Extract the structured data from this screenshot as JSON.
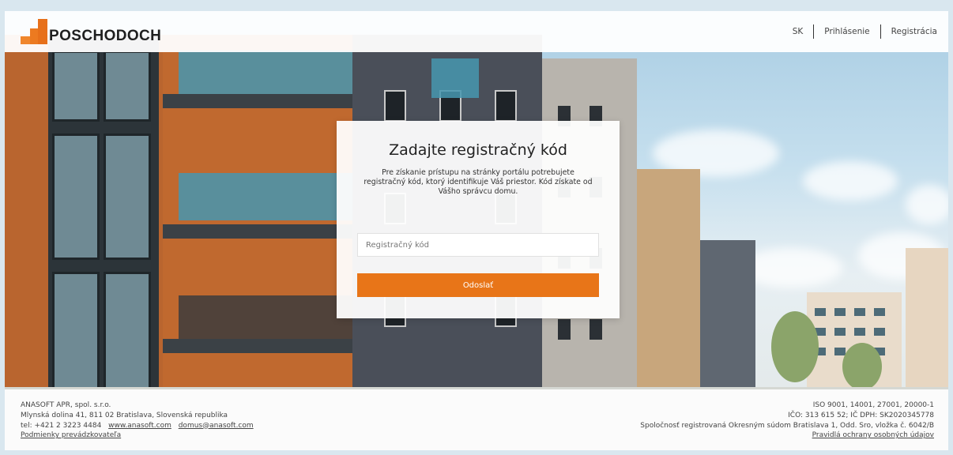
{
  "header": {
    "logo_text": "POSCHODOCH",
    "nav": {
      "language": "SK",
      "login": "Prihlásenie",
      "register": "Registrácia"
    }
  },
  "card": {
    "title": "Zadajte registračný kód",
    "description": "Pre získanie prístupu na stránky portálu potrebujete registračný kód, ktorý identifikuje Váš priestor. Kód získate od Vášho správcu domu.",
    "input_placeholder": "Registračný kód",
    "input_value": "",
    "submit_label": "Odoslať"
  },
  "footer": {
    "left": {
      "company": "ANASOFT APR, spol. s.r.o.",
      "address": "Mlynská dolina 41, 811 02 Bratislava, Slovenská republika",
      "phone": "tel: +421 2 3223 4484",
      "website": "www.anasoft.com",
      "email": "domus@anasoft.com",
      "terms": "Podmienky prevádzkovateľa"
    },
    "right": {
      "iso": "ISO 9001, 14001, 27001, 20000-1",
      "ico": "IČO: 313 615 52; IČ DPH: SK2020345778",
      "registration": "Spoločnosť registrovaná Okresným súdom Bratislava 1, Odd. Sro, vložka č. 6042/B",
      "privacy": "Pravidlá ochrany osobných údajov"
    }
  },
  "colors": {
    "accent": "#e87518",
    "text": "#333333"
  },
  "icons": {
    "logo": "building-steps-logo-icon"
  }
}
